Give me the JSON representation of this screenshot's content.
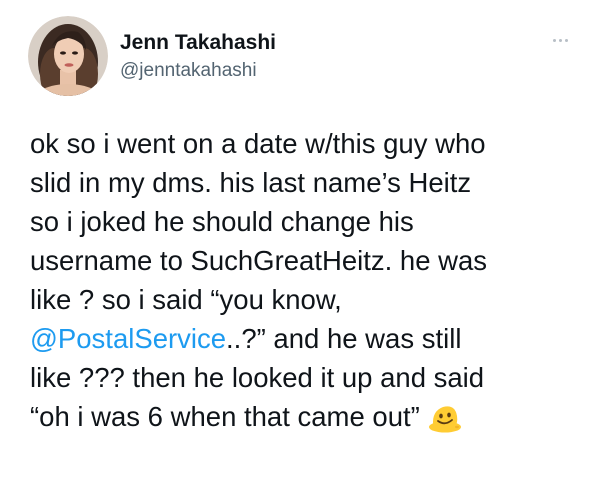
{
  "author": {
    "display_name": "Jenn Takahashi",
    "handle": "@jenntakahashi",
    "avatar_icon": "profile-photo"
  },
  "more_icon": "more-options-icon",
  "tweet": {
    "lines": [
      {
        "text": "ok so i went on a date w/this guy who"
      },
      {
        "text": "slid in my dms. his last name’s Heitz"
      },
      {
        "text": "so i joked he should change his"
      },
      {
        "text": "username to SuchGreatHeitz. he was"
      },
      {
        "text": "like ? so i said “you know,"
      },
      {
        "mention": "@PostalService",
        "after": "..?” and he was still"
      },
      {
        "text": "like ??? then he looked it up and said"
      },
      {
        "text": "“oh i was 6 when that came out”",
        "emoji": "melting-face-emoji"
      }
    ]
  },
  "colors": {
    "text": "#0f1419",
    "secondary": "#536471",
    "link": "#1d9bf0",
    "emoji": "#ffcc33"
  }
}
